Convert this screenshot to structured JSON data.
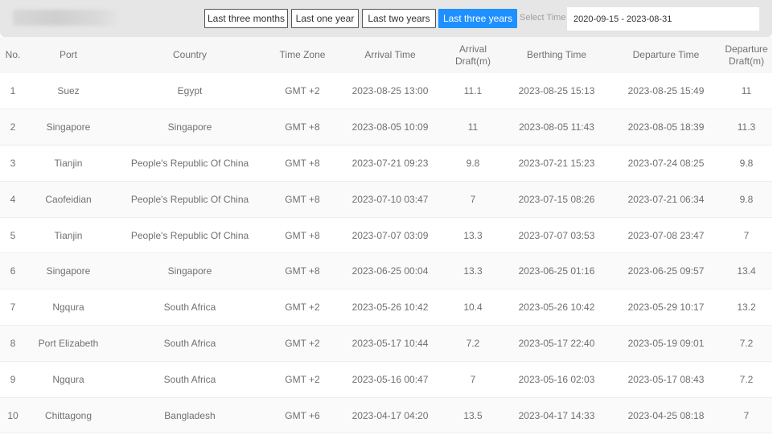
{
  "toolbar": {
    "buttons": [
      "Last three months",
      "Last one year",
      "Last two years",
      "Last three years"
    ],
    "active_button": "Last three years",
    "select_label": "Select Time",
    "date_range": "2020-09-15 - 2023-08-31",
    "accent_color": "#1e90ff"
  },
  "table": {
    "headers": [
      "No.",
      "Port",
      "Country",
      "Time Zone",
      "Arrival Time",
      "Arrival\nDraft(m)",
      "Berthing Time",
      "Departure Time",
      "Departure\nDraft(m)"
    ],
    "rows": [
      [
        "1",
        "Suez",
        "Egypt",
        "GMT +2",
        "2023-08-25 13:00",
        "11.1",
        "2023-08-25 15:13",
        "2023-08-25 15:49",
        "11"
      ],
      [
        "2",
        "Singapore",
        "Singapore",
        "GMT +8",
        "2023-08-05 10:09",
        "11",
        "2023-08-05 11:43",
        "2023-08-05 18:39",
        "11.3"
      ],
      [
        "3",
        "Tianjin",
        "People's Republic Of China",
        "GMT +8",
        "2023-07-21 09:23",
        "9.8",
        "2023-07-21 15:23",
        "2023-07-24 08:25",
        "9.8"
      ],
      [
        "4",
        "Caofeidian",
        "People's Republic Of China",
        "GMT +8",
        "2023-07-10 03:47",
        "7",
        "2023-07-15 08:26",
        "2023-07-21 06:34",
        "9.8"
      ],
      [
        "5",
        "Tianjin",
        "People's Republic Of China",
        "GMT +8",
        "2023-07-07 03:09",
        "13.3",
        "2023-07-07 03:53",
        "2023-07-08 23:47",
        "7"
      ],
      [
        "6",
        "Singapore",
        "Singapore",
        "GMT +8",
        "2023-06-25 00:04",
        "13.3",
        "2023-06-25 01:16",
        "2023-06-25 09:57",
        "13.4"
      ],
      [
        "7",
        "Ngqura",
        "South Africa",
        "GMT +2",
        "2023-05-26 10:42",
        "10.4",
        "2023-05-26 10:42",
        "2023-05-29 10:17",
        "13.2"
      ],
      [
        "8",
        "Port Elizabeth",
        "South Africa",
        "GMT +2",
        "2023-05-17 10:44",
        "7.2",
        "2023-05-17 22:40",
        "2023-05-19 09:01",
        "7.2"
      ],
      [
        "9",
        "Ngqura",
        "South Africa",
        "GMT +2",
        "2023-05-16 00:47",
        "7",
        "2023-05-16 02:03",
        "2023-05-17 08:43",
        "7.2"
      ],
      [
        "10",
        "Chittagong",
        "Bangladesh",
        "GMT +6",
        "2023-04-17 04:20",
        "13.5",
        "2023-04-17 14:33",
        "2023-04-25 08:18",
        "7"
      ]
    ]
  }
}
